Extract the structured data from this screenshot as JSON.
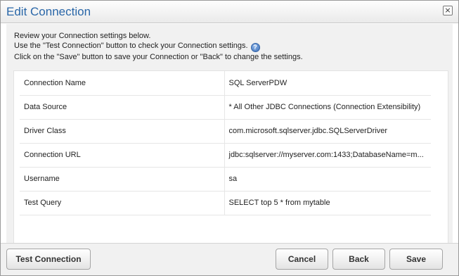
{
  "dialog": {
    "title": "Edit Connection",
    "close_glyph": "×"
  },
  "intro": {
    "line1": "Review your Connection settings below.",
    "line2": "Use the \"Test Connection\" button to check your Connection settings.",
    "help_glyph": "?",
    "line3": "Click on the \"Save\" button to save your Connection or \"Back\" to change the settings."
  },
  "settings": [
    {
      "label": "Connection Name",
      "value": "SQL ServerPDW"
    },
    {
      "label": "Data Source",
      "value": "* All Other JDBC Connections (Connection Extensibility)"
    },
    {
      "label": "Driver Class",
      "value": "com.microsoft.sqlserver.jdbc.SQLServerDriver"
    },
    {
      "label": "Connection URL",
      "value": "jdbc:sqlserver://myserver.com:1433;DatabaseName=m..."
    },
    {
      "label": "Username",
      "value": "sa"
    },
    {
      "label": "Test Query",
      "value": "SELECT top 5 * from mytable"
    }
  ],
  "buttons": {
    "test_connection": "Test Connection",
    "cancel": "Cancel",
    "back": "Back",
    "save": "Save"
  },
  "colors": {
    "title": "#2a67a8",
    "help_icon": "#3d6fb8"
  },
  "icons": {
    "close": "close-icon",
    "help": "help-icon"
  }
}
